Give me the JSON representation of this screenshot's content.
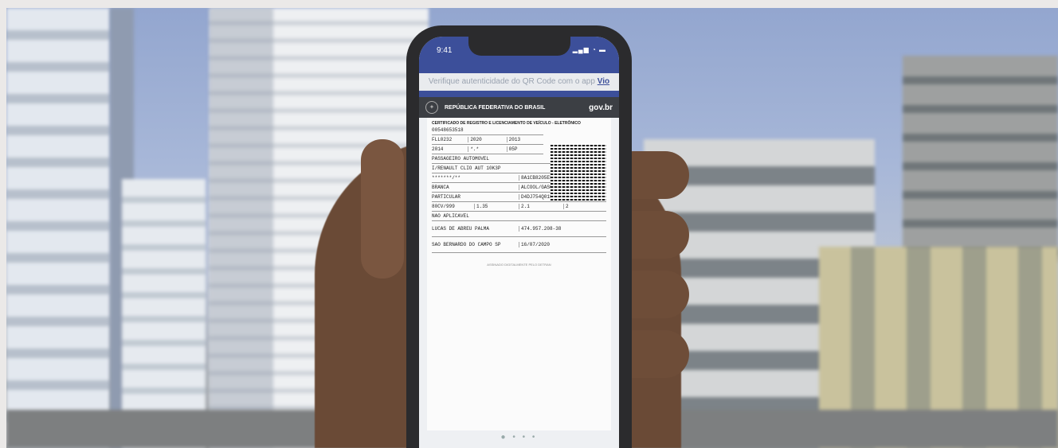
{
  "phone": {
    "time": "9:41",
    "banner_text": "Verifique autenticidade do QR Code com o app ",
    "banner_link": "Vio"
  },
  "doc": {
    "republic": "REPÚBLICA FEDERATIVA DO BRASIL",
    "brand": "gov.br",
    "title": "CERTIFICADO DE REGISTRO E LICENCIAMENTO DE VEÍCULO - ELETRÔNICO",
    "renavam": "00548653518",
    "placa": "FLL0232",
    "exercicio": "2020",
    "ano_fab": "2013",
    "ano_modelo": "2014",
    "capacidade": "*.*",
    "lotacao": "05P",
    "especie": "PASSAGEIRO AUTOMOVEL",
    "marca": "I/RENAULT CLIO AUT 10K3P",
    "placa_ant": "*******/**",
    "chassi": "8A1CB8205EL707379",
    "cor": "BRANCA",
    "combustivel": "ALCOOL/GASOLINA",
    "categoria": "PARTICULAR",
    "motor": "D4DJ754Q018683",
    "potencia": "80CV/999",
    "peso": "1.35",
    "cmt": "2.1",
    "eixos": "2",
    "carroceria": "NAO APLICAVEL",
    "nome": "LUCAS DE ABREU PALMA",
    "cpf": "474.957.208-38",
    "local": "SAO BERNARDO DO CAMPO SP",
    "data": "16/07/2020",
    "signed": "ASSINADO DIGITALMENTE PELO DETRAN"
  }
}
